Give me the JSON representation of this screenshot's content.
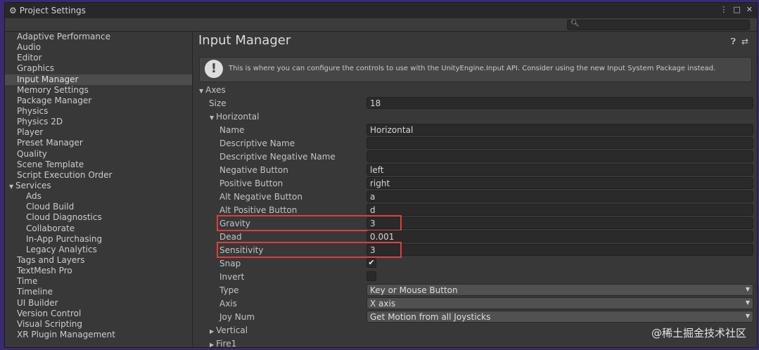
{
  "window": {
    "title": "Project Settings",
    "buttons": [
      "⋮",
      "□",
      "✕"
    ]
  },
  "sidebar": {
    "items": [
      {
        "label": "Adaptive Performance"
      },
      {
        "label": "Audio"
      },
      {
        "label": "Editor"
      },
      {
        "label": "Graphics"
      },
      {
        "label": "Input Manager",
        "selected": true
      },
      {
        "label": "Memory Settings"
      },
      {
        "label": "Package Manager"
      },
      {
        "label": "Physics"
      },
      {
        "label": "Physics 2D"
      },
      {
        "label": "Player"
      },
      {
        "label": "Preset Manager"
      },
      {
        "label": "Quality"
      },
      {
        "label": "Scene Template"
      },
      {
        "label": "Script Execution Order"
      },
      {
        "label": "Services",
        "expanded": true
      },
      {
        "label": "Ads",
        "sub": true
      },
      {
        "label": "Cloud Build",
        "sub": true
      },
      {
        "label": "Cloud Diagnostics",
        "sub": true
      },
      {
        "label": "Collaborate",
        "sub": true
      },
      {
        "label": "In-App Purchasing",
        "sub": true
      },
      {
        "label": "Legacy Analytics",
        "sub": true
      },
      {
        "label": "Tags and Layers"
      },
      {
        "label": "TextMesh Pro"
      },
      {
        "label": "Time"
      },
      {
        "label": "Timeline"
      },
      {
        "label": "UI Builder"
      },
      {
        "label": "Version Control"
      },
      {
        "label": "Visual Scripting"
      },
      {
        "label": "XR Plugin Management"
      }
    ]
  },
  "main": {
    "title": "Input Manager",
    "info": "This is where you can configure the controls to use with the UnityEngine.Input API. Consider using the new Input System Package instead.",
    "axes_label": "Axes",
    "size_label": "Size",
    "size_value": "18",
    "horizontal_label": "Horizontal",
    "fields": [
      {
        "label": "Name",
        "value": "Horizontal"
      },
      {
        "label": "Descriptive Name",
        "value": ""
      },
      {
        "label": "Descriptive Negative Name",
        "value": ""
      },
      {
        "label": "Negative Button",
        "value": "left"
      },
      {
        "label": "Positive Button",
        "value": "right"
      },
      {
        "label": "Alt Negative Button",
        "value": "a"
      },
      {
        "label": "Alt Positive Button",
        "value": "d"
      },
      {
        "label": "Gravity",
        "value": "3",
        "highlight": true
      },
      {
        "label": "Dead",
        "value": "0.001"
      },
      {
        "label": "Sensitivity",
        "value": "3",
        "highlight": true
      }
    ],
    "snap_label": "Snap",
    "snap_checked": true,
    "invert_label": "Invert",
    "invert_checked": false,
    "type_label": "Type",
    "type_value": "Key or Mouse Button",
    "axis_label": "Axis",
    "axis_value": "X axis",
    "joy_label": "Joy Num",
    "joy_value": "Get Motion from all Joysticks",
    "collapsed": [
      "Vertical",
      "Fire1"
    ]
  },
  "watermark": "@稀土掘金技术社区"
}
